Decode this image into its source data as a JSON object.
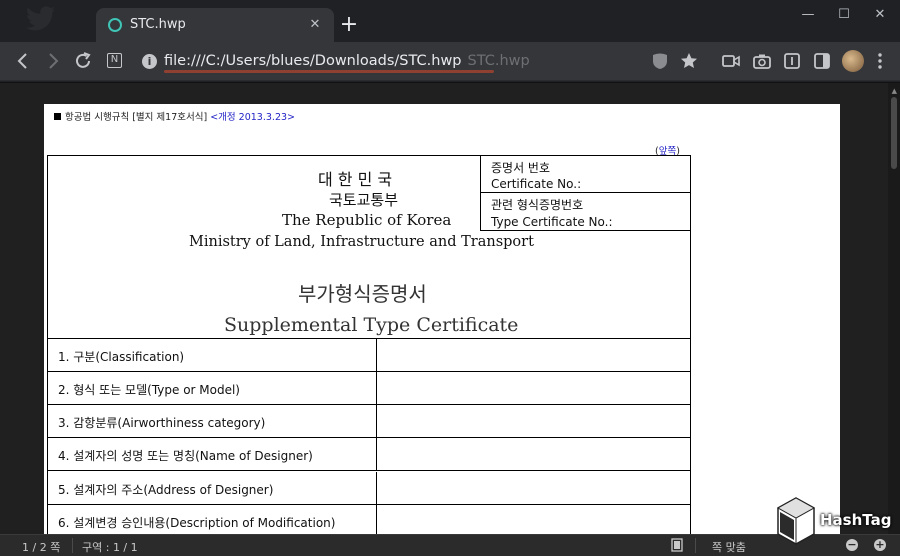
{
  "window": {
    "tab_title": "STC.hwp",
    "tab_close": "✕",
    "new_tab": "+",
    "minimize": "—",
    "maximize": "☐",
    "close": "✕"
  },
  "toolbar": {
    "url": "file:///C:/Users/blues/Downloads/STC.hwp",
    "url_ghost": "STC.hwp",
    "reader_label": "N",
    "info_glyph": "i"
  },
  "document": {
    "law_reference": "항공법 시행규칙 [별지 제17호서식]",
    "law_revision": "<개정 2013.3.23>",
    "front_page_label": "앞쪽",
    "header": {
      "country_kr": "대 한 민 국",
      "ministry_kr": "국토교통부",
      "country_en": "The Republic of Korea",
      "ministry_en": "Ministry of Land, Infrastructure and Transport",
      "title_kr": "부가형식증명서",
      "title_en": "Supplemental Type Certificate"
    },
    "cert_box": {
      "cert_no_kr": "증명서 번호",
      "cert_no_en": "Certificate No.:",
      "type_cert_kr": "관련 형식증명번호",
      "type_cert_en": "Type Certificate No.:"
    },
    "rows": [
      "1. 구분(Classification)",
      "2. 형식 또는 모델(Type or Model)",
      "3. 감항분류(Airworthiness category)",
      "4. 설계자의 성명 또는 명칭(Name of Designer)",
      "5. 설계자의 주소(Address of Designer)",
      "6. 설계변경 승인내용(Description of Modification)"
    ]
  },
  "statusbar": {
    "page_count": "1 / 2 쪽",
    "section": "구역 : 1 / 1",
    "fit_page": "쪽 맞춤"
  },
  "watermark": {
    "brand": "HashTag",
    "badge_text": "Hash Tag"
  },
  "colors": {
    "accent_teal": "#3fc4b5",
    "link_blue": "#2424c8",
    "url_underline": "#b8442e"
  }
}
